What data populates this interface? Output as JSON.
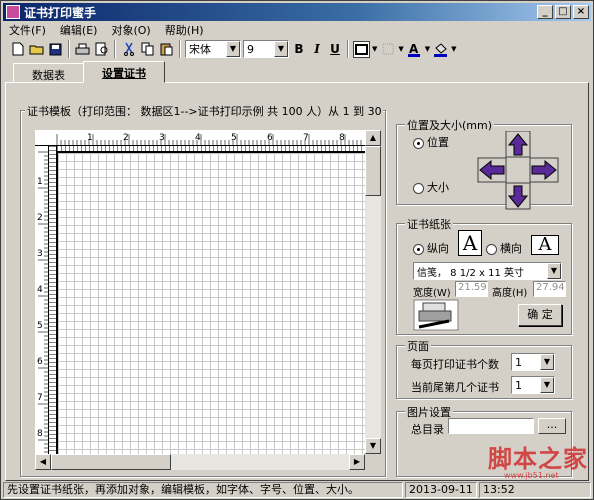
{
  "window": {
    "title": "证书打印蜜手"
  },
  "menu": [
    "文件(F)",
    "编辑(E)",
    "对象(O)",
    "帮助(H)"
  ],
  "toolbar": {
    "font_name": "宋体",
    "font_size": "9",
    "bold": "B",
    "italic": "I",
    "underline": "U"
  },
  "tabs": [
    {
      "label": "数据表"
    },
    {
      "label": "设置证书"
    }
  ],
  "template": {
    "group_title": "证书模板（打印范围： 数据区1-->证书打印示例 共 100 人）从 1 到 30",
    "ruler_top": [
      "1",
      "2",
      "3",
      "4",
      "5",
      "6",
      "7",
      "8"
    ],
    "ruler_left": [
      "1",
      "2",
      "3",
      "4",
      "5",
      "6",
      "7",
      "8"
    ]
  },
  "position": {
    "title": "位置及大小(mm)",
    "opt_position": "位置",
    "opt_size": "大小"
  },
  "paper": {
    "title": "证书纸张",
    "portrait": "纵向",
    "landscape": "横向",
    "paper_glyph": "A",
    "size_value": "信笺， 8 1/2 x 11 英寸",
    "width_label": "宽度(W)",
    "width_value": "21.59",
    "height_label": "高度(H)",
    "height_value": "27.94",
    "ok": "确 定"
  },
  "page": {
    "title": "页面",
    "per_page_label": "每页打印证书个数",
    "per_page_value": "1",
    "tail_label": "当前尾第几个证书",
    "tail_value": "1"
  },
  "picture": {
    "title": "图片设置",
    "dir_label": "总目录",
    "dir_value": "",
    "browse": "..."
  },
  "status": {
    "message": "先设置证书纸张，再添加对象，编辑模板，如字体、字号、位置、大小。",
    "date": "2013-09-11",
    "time": "13:52"
  },
  "watermark": {
    "text": "脚本之家",
    "url": "www.jb51.net"
  }
}
